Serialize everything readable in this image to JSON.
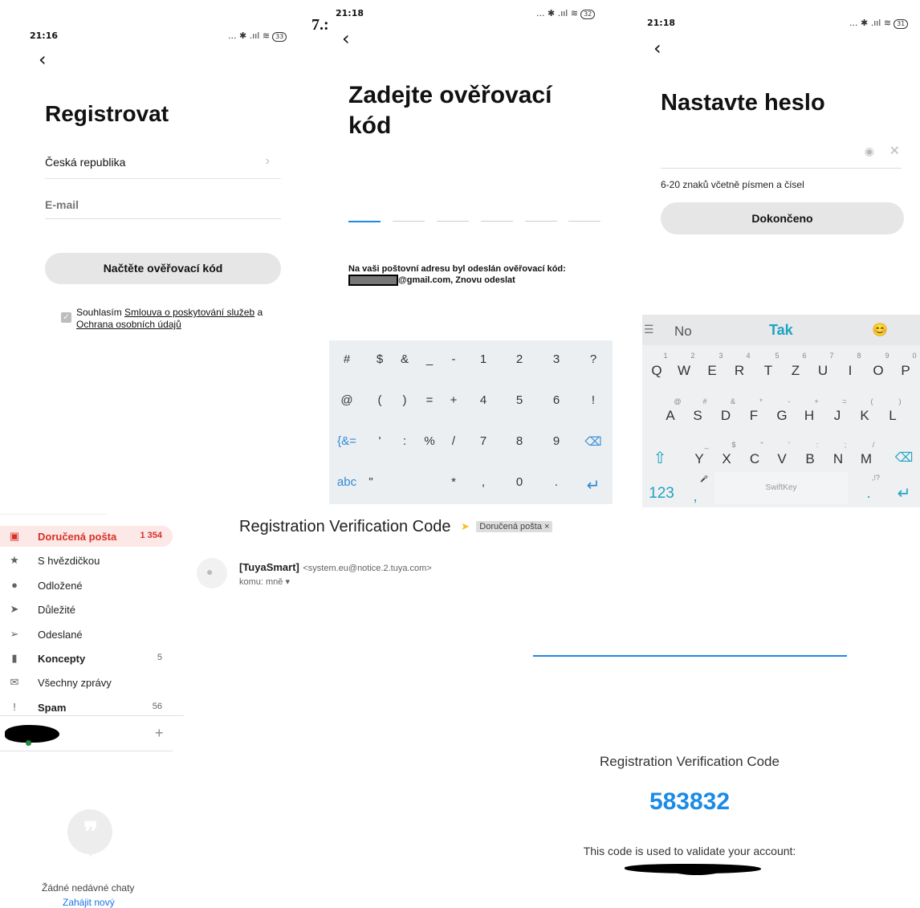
{
  "screen1": {
    "time": "21:16",
    "battery": "33",
    "signal_icons": "... ✱ .ııl ≋",
    "title": "Registrovat",
    "country": "Česká republika",
    "email_placeholder": "E-mail",
    "button": "Načtěte ověřovací kód",
    "consent_prefix": "Souhlasím",
    "consent_link1": "Smlouva o poskytování služeb",
    "consent_and": "a",
    "consent_link2": "Ochrana osobních údajů"
  },
  "overlay_fragment": "7.:",
  "screen2": {
    "time": "21:18",
    "battery": "32",
    "signal_icons": "... ✱ .ııl ≋",
    "title_line1": "Zadejte ověřovací",
    "title_line2": "kód",
    "info_line1": "Na vaši poštovní adresu byl odeslán ověřovací kód:",
    "info_line2": "@gmail.com, Znovu odeslat",
    "keyboard": [
      [
        "#",
        "$",
        "&",
        "_",
        "-",
        "1",
        "2",
        "3",
        "?"
      ],
      [
        "@",
        "(",
        ")",
        "=",
        "+",
        "4",
        "5",
        "6",
        "!"
      ],
      [
        "{&=",
        "'",
        ":",
        "%",
        "/",
        "7",
        "8",
        "9",
        "⌫"
      ],
      [
        "abc",
        "\"",
        "",
        "*",
        ",",
        "0",
        ".",
        "↵"
      ]
    ]
  },
  "screen3": {
    "time": "21:18",
    "battery": "31",
    "signal_icons": "... ✱ .ııl ≋",
    "title": "Nastavte heslo",
    "hint": "6-20 znaků včetně písmen a čísel",
    "button": "Dokončeno",
    "suggestions": [
      "No",
      "Tak",
      "😊"
    ],
    "row1": [
      "Q",
      "W",
      "E",
      "R",
      "T",
      "Z",
      "U",
      "I",
      "O",
      "P"
    ],
    "row1_hints": [
      "1",
      "2",
      "3",
      "4",
      "5",
      "6",
      "7",
      "8",
      "9",
      "0"
    ],
    "row2": [
      "A",
      "S",
      "D",
      "F",
      "G",
      "H",
      "J",
      "K",
      "L"
    ],
    "row2_hints": [
      "@",
      "#",
      "&",
      "*",
      "-",
      "+",
      "=",
      "(",
      ")"
    ],
    "row3": [
      "Y",
      "X",
      "C",
      "V",
      "B",
      "N",
      "M"
    ],
    "row3_hints": [
      "_",
      "$",
      "\"",
      "'",
      ":",
      ";",
      "/"
    ],
    "numbers_key": "123",
    "comma": ",",
    "space_label": "SwiftKey",
    "period": ".",
    "punct_hint": ",!?"
  },
  "gmail_sidebar": {
    "items": [
      {
        "label": "Doručená pošta",
        "count": "1 354",
        "icon": "inbox-icon",
        "glyph": "▣"
      },
      {
        "label": "S hvězdičkou",
        "count": "",
        "icon": "star-icon",
        "glyph": "★"
      },
      {
        "label": "Odložené",
        "count": "",
        "icon": "clock-icon",
        "glyph": "●"
      },
      {
        "label": "Důležité",
        "count": "",
        "icon": "important-icon",
        "glyph": "➤"
      },
      {
        "label": "Odeslané",
        "count": "",
        "icon": "send-icon",
        "glyph": "➢"
      },
      {
        "label": "Koncepty",
        "count": "5",
        "icon": "draft-icon",
        "glyph": "▮"
      },
      {
        "label": "Všechny zprávy",
        "count": "",
        "icon": "mail-icon",
        "glyph": "✉"
      },
      {
        "label": "Spam",
        "count": "56",
        "icon": "spam-icon",
        "glyph": "!"
      }
    ],
    "add": "+",
    "no_chats": "Žádné nedávné chaty",
    "start_new": "Zahájit nový"
  },
  "email": {
    "subject": "Registration Verification Code",
    "label_chip": "Doručená pošta ×",
    "sender_name": "[TuyaSmart]",
    "sender_email": "<system.eu@notice.2.tuya.com>",
    "to": "komu: mně ▾",
    "body_title": "Registration Verification Code",
    "code": "583832",
    "validate_text": "This code is used to validate your account:"
  },
  "colors": {
    "accent_blue": "#1e88e5",
    "code_blue": "#1a8be6",
    "gmail_red": "#d93025",
    "inbox_bg": "#fce8e6",
    "swiftkey_teal": "#1ea3c4"
  }
}
